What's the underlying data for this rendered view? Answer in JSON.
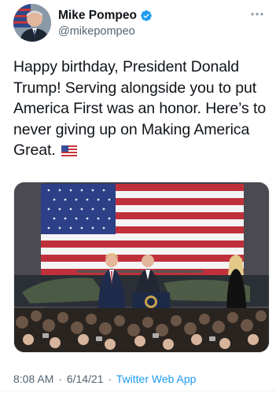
{
  "tweet": {
    "author": {
      "display_name": "Mike Pompeo",
      "handle": "@mikepompeo",
      "verified": true,
      "avatar_icon": "profile-photo"
    },
    "more_icon": "ellipsis-icon",
    "text": "Happy birthday, President Donald Trump! Serving alongside you to put America First was an honor. Here’s to never giving up on Making America Great.",
    "emoji": "us-flag-emoji",
    "media_icon": "event-photo",
    "time": "8:08 AM",
    "separator": "·",
    "date": "6/14/21",
    "source": "Twitter Web App"
  },
  "colors": {
    "text": "#0f1419",
    "secondary": "#536471",
    "accent": "#1d9bf0"
  }
}
